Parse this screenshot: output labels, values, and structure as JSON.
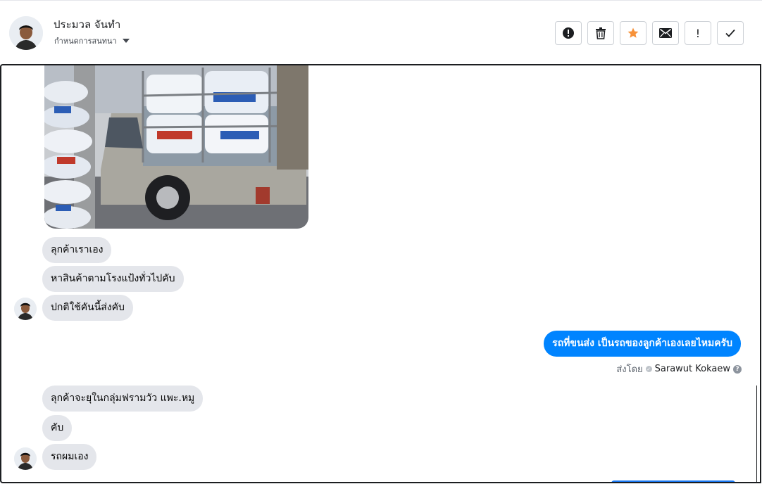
{
  "header": {
    "contact_name": "ประมวล จันทำ",
    "assign_label": "กำหนดการสนทนา",
    "actions": [
      {
        "icon": "alert-circle-icon"
      },
      {
        "icon": "trash-icon"
      },
      {
        "icon": "star-icon"
      },
      {
        "icon": "envelope-icon"
      },
      {
        "icon": "exclamation-icon",
        "glyph": "!"
      },
      {
        "icon": "checkmark-icon"
      }
    ]
  },
  "messages": {
    "photo": {
      "icon": "pickup-truck-photo"
    },
    "incoming_1": [
      "ลุกค้าเราเอง",
      "หาสินค้าตามโรงแป้งทั่วไปคับ",
      "ปกติใช้คันนี้ส่งคับ"
    ],
    "outgoing": "รถที่ขนส่ง เป็นรถของลูกค้าเองเลยไหมครับ",
    "sent_by_label": "ส่งโดย",
    "sent_by_agent": "Sarawut Kokaew",
    "incoming_2": [
      "ลุกค้าจะยุในกลุ่มฟรามวัว แพะ.หมู",
      "คับ",
      "รถผมเอง"
    ]
  },
  "colors": {
    "outgoing_bubble": "#0084ff",
    "incoming_bubble": "#e4e6eb",
    "star": "#f7923a"
  }
}
